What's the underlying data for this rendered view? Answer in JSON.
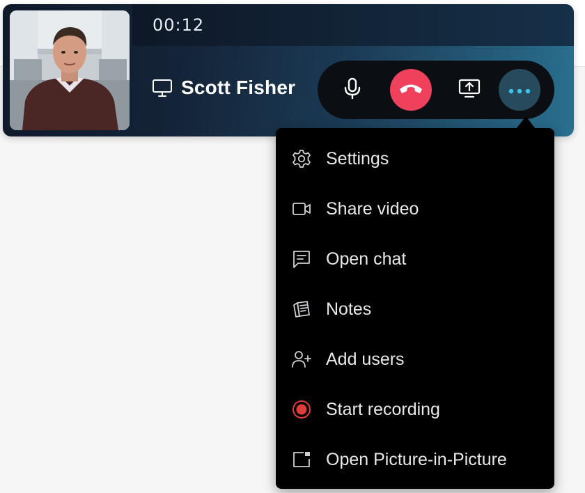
{
  "call": {
    "timer": "00:12",
    "caller_name": "Scott Fisher"
  },
  "controls": {
    "mic_icon": "microphone-icon",
    "hangup_icon": "phone-hangup-icon",
    "share_icon": "screen-share-icon",
    "more_icon": "more-dots-icon"
  },
  "menu": {
    "items": [
      {
        "label": "Settings",
        "icon": "gear-icon"
      },
      {
        "label": "Share video",
        "icon": "video-camera-icon"
      },
      {
        "label": "Open chat",
        "icon": "chat-icon"
      },
      {
        "label": "Notes",
        "icon": "notes-icon"
      },
      {
        "label": "Add users",
        "icon": "add-user-icon"
      },
      {
        "label": "Start recording",
        "icon": "record-icon"
      },
      {
        "label": "Open Picture-in-Picture",
        "icon": "picture-in-picture-icon"
      }
    ]
  },
  "colors": {
    "hangup": "#f0415c",
    "more_button": "#274b5c",
    "more_dots": "#3ec6ef",
    "record": "#e03a3a",
    "menu_bg": "#000000",
    "menu_text": "#e8e8ea"
  }
}
